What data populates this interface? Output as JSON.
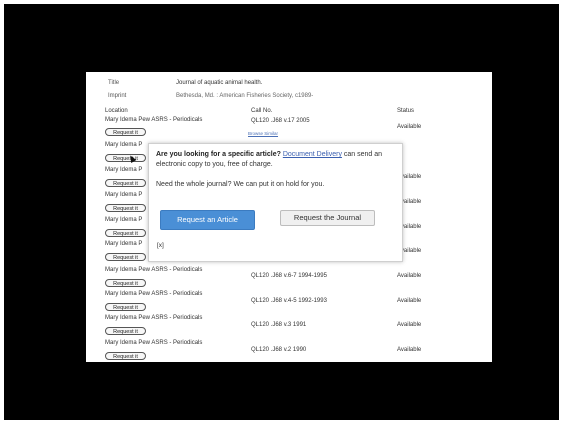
{
  "meta": {
    "title_label": "Title",
    "title_value": "Journal of aquatic animal health.",
    "imprint_label": "Imprint",
    "imprint_value": "Bethesda, Md. : American Fisheries Society, c1989-"
  },
  "table": {
    "headers": {
      "location": "Location",
      "call_no": "Call No.",
      "status": "Status"
    },
    "request_label": "Request it",
    "browse_similar": "Browse Similar",
    "rows": [
      {
        "location": "Mary Idema Pew ASRS - Periodicals",
        "call_no": "QL120 .J68  v.17 2005",
        "status": "Available"
      },
      {
        "location": "Mary Idema P",
        "call_no": "",
        "status": ""
      },
      {
        "location": "Mary Idema P",
        "call_no": "",
        "status": "Available"
      },
      {
        "location": "Mary Idema P",
        "call_no": "",
        "status": "Available"
      },
      {
        "location": "Mary Idema P",
        "call_no": "",
        "status": "Available"
      },
      {
        "location": "Mary Idema P",
        "call_no": "",
        "status": "Available"
      },
      {
        "location": "Mary Idema Pew ASRS - Periodicals",
        "call_no": "QL120 .J68  v.6-7 1994-1995",
        "status": "Available"
      },
      {
        "location": "Mary Idema Pew ASRS - Periodicals",
        "call_no": "QL120 .J68  v.4-5 1992-1993",
        "status": "Available"
      },
      {
        "location": "Mary Idema Pew ASRS - Periodicals",
        "call_no": "QL120 .J68  v.3 1991",
        "status": "Available"
      },
      {
        "location": "Mary Idema Pew ASRS - Periodicals",
        "call_no": "QL120 .J68  v.2 1990",
        "status": "Available"
      }
    ]
  },
  "popup": {
    "question_bold": "Are you looking for a specific article?",
    "delivery_link": "Document Delivery",
    "question_rest": " can send an electronic copy to you, free of charge.",
    "hold_text": "Need the whole journal? We can put it on hold for you.",
    "request_article": "Request an Article",
    "request_journal": "Request the Journal",
    "close": "[x]"
  },
  "colors": {
    "primary_button": "#4a8fd6",
    "link": "#3a5fb0",
    "frame": "#000000"
  }
}
